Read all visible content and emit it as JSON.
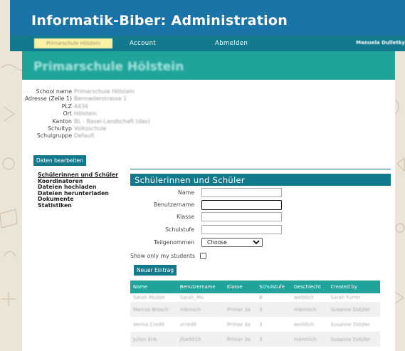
{
  "app": {
    "title": "Informatik-Biber: Administration"
  },
  "nav": {
    "school_chip": "Primarschule Hölstein",
    "account": "Account",
    "logout": "Abmelden",
    "user": "Manuela Dulletky"
  },
  "banner": {
    "school_name": "Primarschule Hölstein"
  },
  "school_info": {
    "rows": [
      {
        "label": "School name",
        "value": "Primarschule Hölstein"
      },
      {
        "label": "Adresse (Zeile 1)",
        "value": "Bennwilerstrasse 1"
      },
      {
        "label": "PLZ",
        "value": "4434"
      },
      {
        "label": "Ort",
        "value": "Hölstein"
      },
      {
        "label": "Kanton",
        "value": "BL - Basel-Landschaft (das)"
      },
      {
        "label": "Schultyp",
        "value": "Volksschule"
      },
      {
        "label": "Schulgruppe",
        "value": "Default"
      }
    ],
    "edit_button": "Daten bearbeiten"
  },
  "sidebar": {
    "items": [
      "Schülerinnen und Schüler",
      "Koordinatoren",
      "Dateien hochladen",
      "Dateien herunterladen",
      "Dokumente",
      "Statistiken"
    ]
  },
  "students": {
    "heading": "Schülerinnen und Schüler",
    "filters": {
      "name_label": "Name",
      "username_label": "Benutzername",
      "class_label": "Klasse",
      "grade_label": "Schulstufe",
      "participated_label": "Teilgenommen",
      "participated_value": "Choose"
    },
    "only_mine_label": "Show only my students",
    "new_button": "Neuer Eintrag",
    "columns": [
      "Name",
      "Benutzername",
      "Klasse",
      "Schulstufe",
      "Geschlecht",
      "Created by"
    ],
    "rows": [
      [
        "Sarah Muster",
        "Sarah_Mu",
        "",
        "8",
        "weiblich",
        "Sarah Furrer"
      ],
      [
        "Marcus Brosch",
        "mbrosch",
        "Primar 3a",
        "3",
        "männlich",
        "Susanne Dotzler"
      ],
      [
        "Verina Credit",
        "vcredit",
        "Primar 3a",
        "3",
        "weiblich",
        "Susanne Dotzler"
      ],
      [
        "Julien Erik",
        "jfox0010",
        "Primar 3a",
        "3",
        "männlich",
        "Susanne Dotzler"
      ]
    ]
  }
}
